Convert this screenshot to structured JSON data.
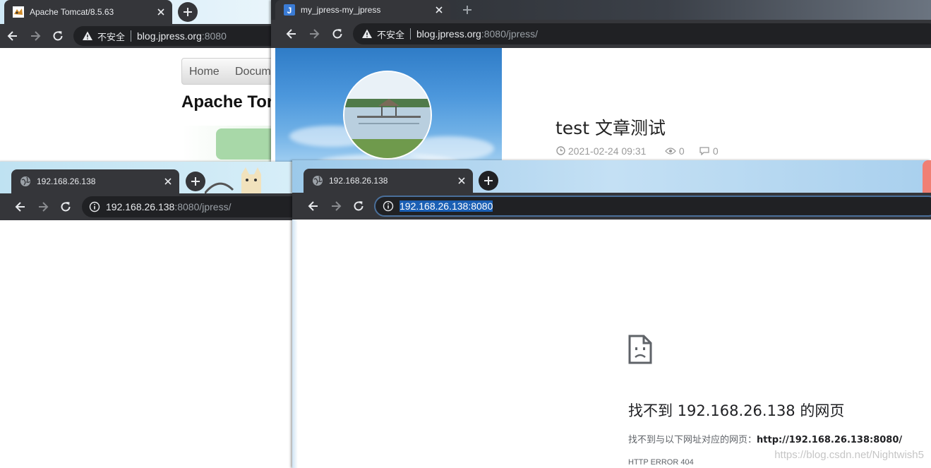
{
  "windows": {
    "tomcat": {
      "tab_title": "Apache Tomcat/8.5.63",
      "security_label": "不安全",
      "url_host": "blog.jpress.org",
      "url_rest": ":8080",
      "nav": {
        "home": "Home",
        "docs": "Docum"
      },
      "heading": "Apache Tor"
    },
    "jpress": {
      "tab_title": "my_jpress-my_jpress",
      "security_label": "不安全",
      "url_host": "blog.jpress.org",
      "url_rest": ":8080/jpress/",
      "post_title": "test 文章测试",
      "post_date": "2021-02-24 09:31",
      "views": "0",
      "comments": "0"
    },
    "ip_jpress": {
      "tab_title": "192.168.26.138",
      "url_host": "192.168.26.138",
      "url_rest": ":8080/jpress/"
    },
    "ip_root": {
      "tab_title": "192.168.26.138",
      "url": "192.168.26.138:8080",
      "error_title": "找不到 192.168.26.138 的网页",
      "error_desc_prefix": "找不到与以下网址对应的网页：",
      "error_desc_url": "http://192.168.26.138:8080/",
      "error_code": "HTTP ERROR 404"
    }
  },
  "watermark": "https://blog.csdn.net/Nightwish5",
  "colors": {
    "tab_strip": "#202124",
    "toolbar": "#35363a",
    "omnibox": "#202124",
    "selection": "#1a5fb4"
  }
}
